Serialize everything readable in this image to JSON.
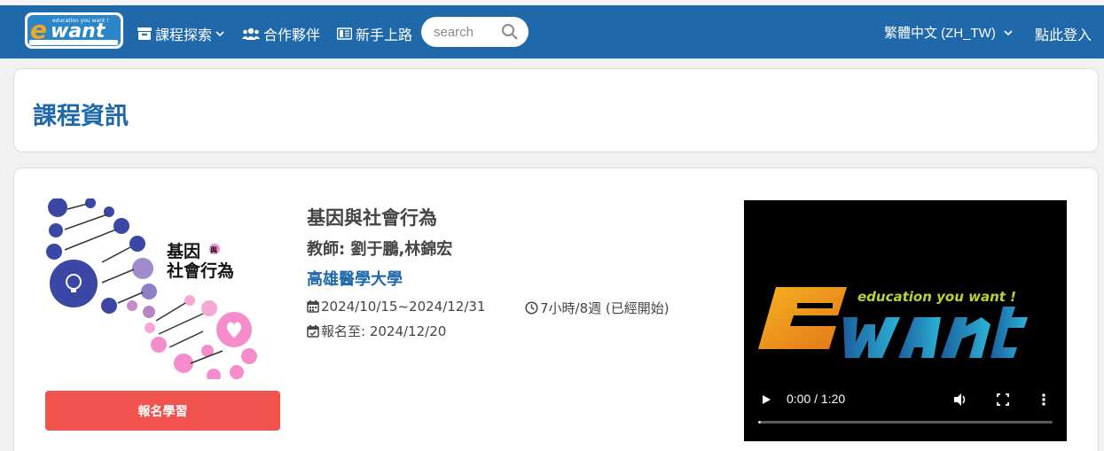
{
  "header": {
    "logo_alt": "ewant",
    "nav": [
      {
        "label": "課程探索",
        "icon": "archive-icon",
        "has_dropdown": true
      },
      {
        "label": "合作夥伴",
        "icon": "users-icon"
      },
      {
        "label": "新手上路",
        "icon": "book-icon"
      }
    ],
    "search_placeholder": "search",
    "language": "繁體中文 (ZH_TW)",
    "login": "點此登入"
  },
  "page": {
    "title": "課程資訊"
  },
  "course": {
    "name": "基因與社會行為",
    "teacher": "教師: 劉于鵬,林錦宏",
    "school": "高雄醫學大學",
    "dates": "2024/10/15~2024/12/31",
    "duration": "7小時/8週 (已經開始)",
    "enroll_deadline": "報名至:  2024/12/20",
    "image_title_line1": "基因",
    "image_title_small": "與",
    "image_title_line2": "社會行為",
    "enroll_button": "報名學習"
  },
  "video": {
    "logo_text": "education you want !",
    "time": "0:00 / 1:20",
    "progress": 0.01
  },
  "colors": {
    "brand_blue": "#1f69ab",
    "enroll_red": "#f0524d"
  }
}
